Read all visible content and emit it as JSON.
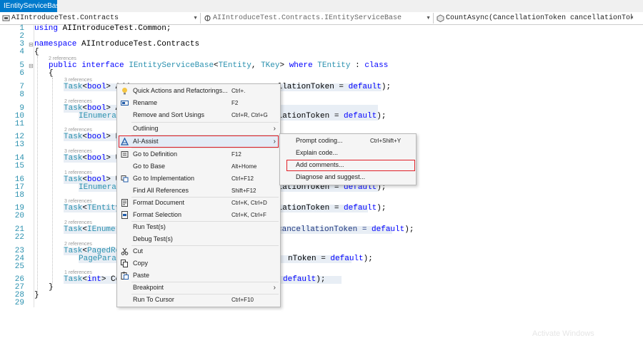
{
  "tab": {
    "label": "IEntityServiceBase.cs"
  },
  "nav": {
    "project": "AIIntroduceTest.Contracts",
    "type": "AIIntroduceTest.Contracts.IEntityServiceBase",
    "member": "CountAsync(CancellationToken cancellationToken = default)"
  },
  "editor": {
    "line_numbers": [
      "1",
      "2",
      "3",
      "4",
      "5",
      "6",
      "7",
      "8",
      "9",
      "10",
      "11",
      "12",
      "13",
      "14",
      "15",
      "16",
      "17",
      "18",
      "19",
      "20",
      "21",
      "22",
      "23",
      "24",
      "25",
      "26",
      "27",
      "28",
      "29"
    ],
    "refs": {
      "r2": "2 references",
      "r3": "3 references",
      "r1": "1 references"
    },
    "code": {
      "l1_kw": "using",
      "l1_rest": " AIIntroduceTest.Common;",
      "l3_kw": "namespace",
      "l3_rest": " AIIntroduceTest.Contracts",
      "brace_open": "{",
      "brace_close": "}",
      "l5_kw1": "public",
      "l5_kw2": " interface",
      "l5_type": " IEntityServiceBase",
      "l5_gen1": "<",
      "l5_t1": "TEntity",
      "l5_comma": ", ",
      "l5_t2": "TKey",
      "l5_gen2": ">",
      "l5_where": " where",
      "l5_t3": " TEntity",
      "l5_colon": " :",
      "l5_class": " class",
      "task": "Task",
      "lt": "<",
      "gt": ">",
      "bool": "bool",
      "int": "int",
      "tentity_q": "TEntity?",
      "ienum_pre": "IEnumerab",
      "ienum_short": "IEnumerabl",
      "paged": "PagedResu",
      "pageparam": "PageParame",
      "add": " Add",
      "del": " Del",
      "upd": " Upd",
      "coun": " Coun",
      "tail_a": "ellationToken = ",
      "tail_b": "llationToken = ",
      "tail_c": "cancellationToken = ",
      "tail_d": "nToken = ",
      "default": "default",
      "end": ");"
    }
  },
  "context_menu": {
    "items": [
      {
        "label": "Quick Actions and Refactorings...",
        "shortcut": "Ctrl+."
      },
      {
        "label": "Rename",
        "shortcut": "F2"
      },
      {
        "label": "Remove and Sort Usings",
        "shortcut": "Ctrl+R, Ctrl+G"
      },
      {
        "label": "Outlining",
        "shortcut": ""
      },
      {
        "label": "AI-Assist",
        "shortcut": ""
      },
      {
        "label": "Go to Definition",
        "shortcut": "F12"
      },
      {
        "label": "Go to Base",
        "shortcut": "Alt+Home"
      },
      {
        "label": "Go to Implementation",
        "shortcut": "Ctrl+F12"
      },
      {
        "label": "Find All References",
        "shortcut": "Shift+F12"
      },
      {
        "label": "Format Document",
        "shortcut": "Ctrl+K, Ctrl+D"
      },
      {
        "label": "Format Selection",
        "shortcut": "Ctrl+K, Ctrl+F"
      },
      {
        "label": "Run Test(s)",
        "shortcut": ""
      },
      {
        "label": "Debug Test(s)",
        "shortcut": ""
      },
      {
        "label": "Cut",
        "shortcut": ""
      },
      {
        "label": "Copy",
        "shortcut": ""
      },
      {
        "label": "Paste",
        "shortcut": ""
      },
      {
        "label": "Breakpoint",
        "shortcut": ""
      },
      {
        "label": "Run To Cursor",
        "shortcut": "Ctrl+F10"
      }
    ]
  },
  "submenu": {
    "items": [
      {
        "label": "Prompt coding...",
        "shortcut": "Ctrl+Shift+Y"
      },
      {
        "label": "Explain code...",
        "shortcut": ""
      },
      {
        "label": "Add comments...",
        "shortcut": ""
      },
      {
        "label": "Diagnose and suggest...",
        "shortcut": ""
      }
    ]
  },
  "colors": {
    "accent": "#007acc",
    "highlight_box": "#e01f26",
    "keyword": "#0000ff",
    "type": "#2b91af"
  },
  "watermark": "Activate Windows"
}
